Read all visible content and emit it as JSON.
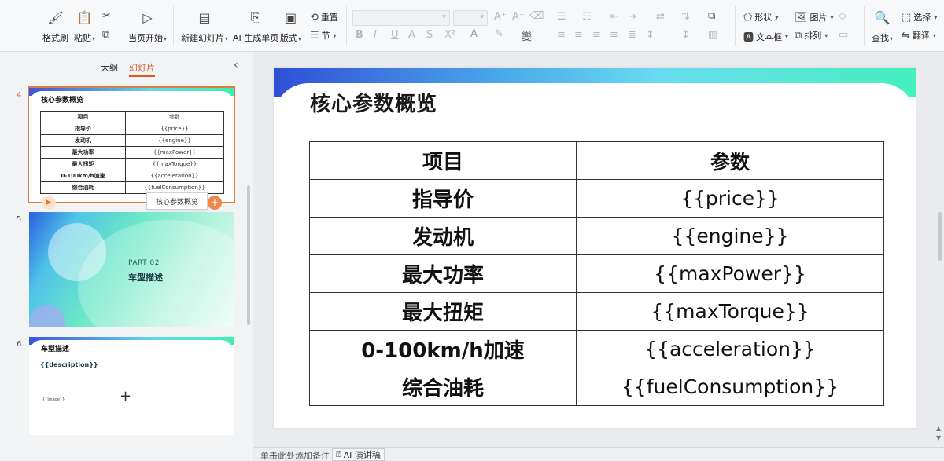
{
  "ribbon": {
    "format_painter": "格式刷",
    "paste": "粘贴",
    "from_current": "当页开始",
    "new_slide": "新建幻灯片",
    "ai_single_page": "AI 生成单页",
    "layout": "版式",
    "reset": "重置",
    "section": "节",
    "shape": "形状",
    "picture": "图片",
    "textbox": "文本框",
    "arrange": "排列",
    "find": "查找",
    "select": "选择",
    "translate": "翻译"
  },
  "panel": {
    "tab_outline": "大纲",
    "tab_slides": "幻灯片"
  },
  "thumbs": [
    {
      "number": "4",
      "title": "核心参数概览",
      "header": [
        "项目",
        "参数"
      ],
      "rows": [
        [
          "指导价",
          "{{price}}"
        ],
        [
          "发动机",
          "{{engine}}"
        ],
        [
          "最大功率",
          "{{maxPower}}"
        ],
        [
          "最大扭矩",
          "{{maxTorque}}"
        ],
        [
          "0-100km/h加速",
          "{{acceleration}}"
        ],
        [
          "综合油耗",
          "{{fuelConsumption}}"
        ]
      ],
      "tooltip": "核心参数概览"
    },
    {
      "number": "5",
      "part": "PART 02",
      "title": "车型描述"
    },
    {
      "number": "6",
      "title": "车型描述",
      "desc": "{{description}}",
      "image": "{{image}}"
    }
  ],
  "slide": {
    "title": "核心参数概览",
    "header": [
      "项目",
      "参数"
    ],
    "rows": [
      [
        "指导价",
        "{{price}}"
      ],
      [
        "发动机",
        "{{engine}}"
      ],
      [
        "最大功率",
        "{{maxPower}}"
      ],
      [
        "最大扭矩",
        "{{maxTorque}}"
      ],
      [
        "0-100km/h加速",
        "{{acceleration}}"
      ],
      [
        "综合油耗",
        "{{fuelConsumption}}"
      ]
    ]
  },
  "notes": {
    "placeholder": "单击此处添加备注",
    "ai_script": "AI 演讲稿"
  },
  "colors": {
    "accent": "#d8582a",
    "gradient_start": "#2f4fd6",
    "gradient_end": "#45f0bd"
  }
}
